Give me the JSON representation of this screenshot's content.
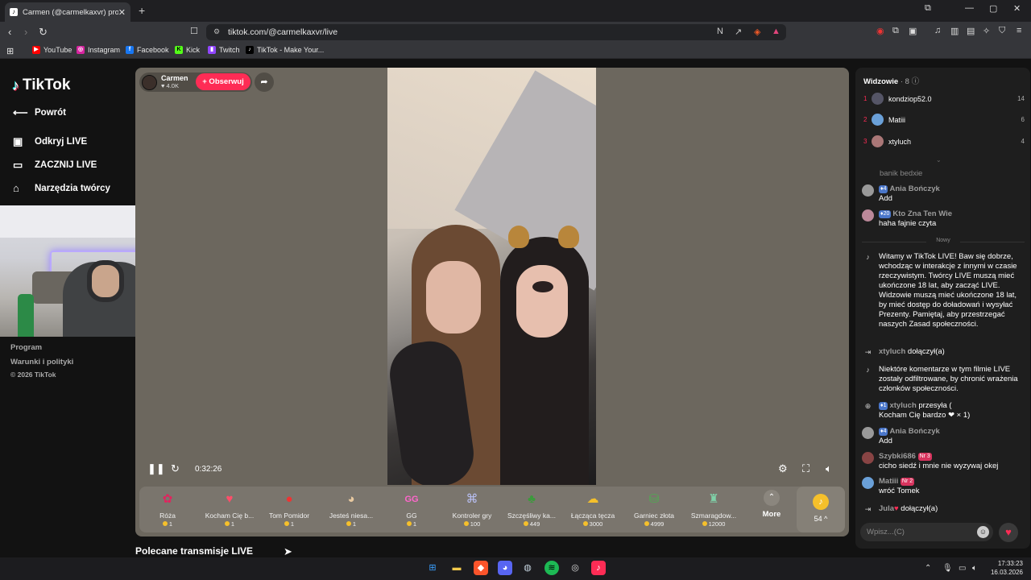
{
  "browser": {
    "tab_title": "Carmen (@carmelkaxvr) prov",
    "url": "tiktok.com/@carmelkaxvr/live",
    "bookmarks": [
      "YouTube",
      "Instagram",
      "Facebook",
      "Kick",
      "Twitch",
      "TikTok - Make Your..."
    ]
  },
  "sidebar": {
    "logo": "TikTok",
    "back": "Powrót",
    "items": [
      "Odkryj LIVE",
      "ZACZNIJ LIVE",
      "Narzędzia twórcy"
    ],
    "footer": [
      "Program",
      "Warunki i polityki",
      "© 2026 TikTok"
    ]
  },
  "player": {
    "streamer_name": "Carmen",
    "likes": "♥ 4.0K",
    "follow_label": "+ Obserwuj",
    "elapsed": "0:32:26",
    "gifts": [
      {
        "name": "Róża",
        "price": "1"
      },
      {
        "name": "Kocham Cię b...",
        "price": "1"
      },
      {
        "name": "Tom Pomidor",
        "price": "1"
      },
      {
        "name": "Jesteś niesa...",
        "price": "1"
      },
      {
        "name": "GG",
        "price": "1"
      },
      {
        "name": "Kontroler gry",
        "price": "100"
      },
      {
        "name": "Szczęśliwy ka...",
        "price": "449"
      },
      {
        "name": "Łącząca tęcza",
        "price": "3000"
      },
      {
        "name": "Garniec złota",
        "price": "4999"
      },
      {
        "name": "Szmaragdow...",
        "price": "12000"
      }
    ],
    "more_label": "More",
    "coins_label": "54 ^"
  },
  "recommended_title": "Polecane transmisje LIVE",
  "chat": {
    "header": "Widzowie",
    "viewer_count": "· 8",
    "top_viewers": [
      {
        "rank": "1",
        "name": "kondziop52.0",
        "score": "14"
      },
      {
        "rank": "2",
        "name": "Matiii",
        "score": "6"
      },
      {
        "rank": "3",
        "name": "xtyluch",
        "score": "4"
      }
    ],
    "faded_msg": "banik bedxie",
    "m1_user": "Ania Bończyk",
    "m1_level": "4",
    "m1_text": "Add",
    "m2_user": "Kto Zna Ten Wie",
    "m2_level": "20",
    "m2_text": "haha fajnie czyta",
    "new_label": "Nowy",
    "welcome": "Witamy w TikTok LIVE! Baw się dobrze, wchodząc w interakcje z innymi w czasie rzeczywistym. Twórcy LIVE muszą mieć ukończone 18 lat, aby zacząć LIVE. Widzowie muszą mieć ukończone 18 lat, by mieć dostęp do doładowań i wysyłać Prezenty. Pamiętaj, aby przestrzegać naszych Zasad społeczności.",
    "j1_user": "xtyluch",
    "joined": "dołączył(a)",
    "filter_note": "Niektóre komentarze w tym filmie LIVE zostały odfiltrowane, by chronić wrażenia członków społeczności.",
    "g_user": "xtyluch",
    "g_level": "1",
    "g_action": "przesyła (",
    "g_text": "Kocham Cię bardzo ❤ × 1)",
    "m3_user": "Ania Bończyk",
    "m3_level": "4",
    "m3_text": "Add",
    "m4_user": "Szybki686",
    "m4_badge": "Nr 3",
    "m4_text": "cicho siedź i mnie nie wyzywaj okej",
    "m5_user": "Matiii",
    "m5_badge": "Nr 2",
    "m5_text": "wróć Tomek",
    "j2_user": "Jula",
    "input_placeholder": "Wpisz...(C)"
  },
  "clock": {
    "time": "17:33:23",
    "date": "16.03.2026"
  }
}
